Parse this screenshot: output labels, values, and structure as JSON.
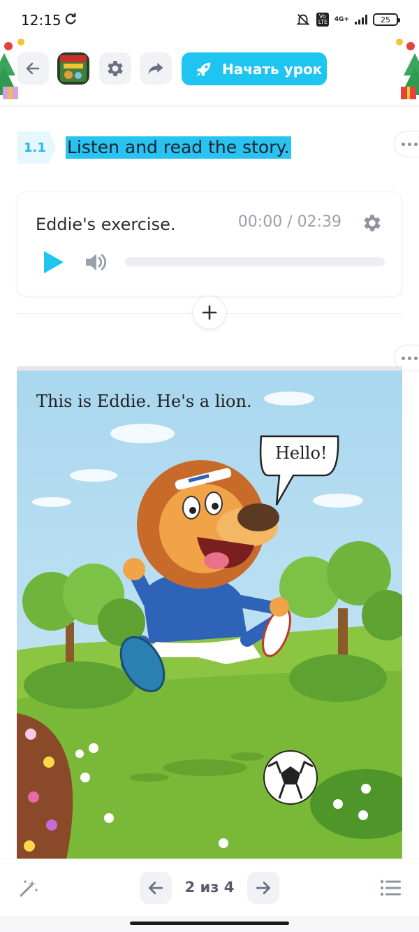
{
  "status_bar": {
    "time": "12:15",
    "volte": "Vo LTE",
    "network": "4G+",
    "battery": "25"
  },
  "toolbar": {
    "start_lesson_label": "Начать урок",
    "accent_color": "#1ec5f0"
  },
  "task": {
    "number": "1.1",
    "title": "Listen and read the story."
  },
  "audio": {
    "title": "Eddie's exercise.",
    "time": "00:00 / 02:39",
    "progress_fraction": 0
  },
  "story": {
    "caption": "This is Eddie. He's a lion.",
    "speech": "Hello!"
  },
  "pagination": {
    "current": "2 из 4"
  }
}
